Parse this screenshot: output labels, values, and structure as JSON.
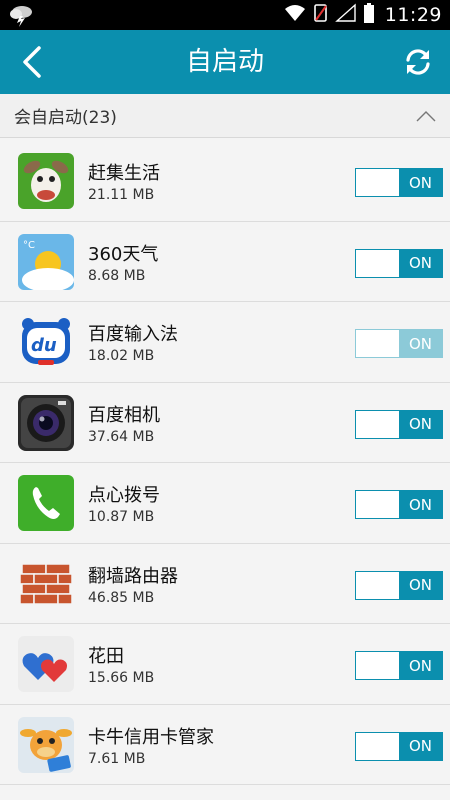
{
  "status_bar": {
    "time": "11:29",
    "icons": [
      "weather-icon",
      "wifi-icon",
      "sim-icon",
      "signal-icon",
      "battery-icon"
    ]
  },
  "app_bar": {
    "title": "自启动",
    "back_icon": "back-arrow-icon",
    "refresh_icon": "refresh-icon"
  },
  "section": {
    "label": "会自启动(23)",
    "expand_icon": "chevron-up-icon"
  },
  "apps": [
    {
      "name": " 赶集生活",
      "size": "21.11 MB",
      "icon": "ganji-app-icon",
      "toggle": "ON",
      "dim": false
    },
    {
      "name": "360天气",
      "size": "8.68 MB",
      "icon": "weather360-app-icon",
      "toggle": "ON",
      "dim": false
    },
    {
      "name": "百度输入法",
      "size": "18.02 MB",
      "icon": "baidu-input-app-icon",
      "toggle": "ON",
      "dim": true
    },
    {
      "name": "百度相机",
      "size": "37.64 MB",
      "icon": "baidu-camera-app-icon",
      "toggle": "ON",
      "dim": false
    },
    {
      "name": "点心拨号",
      "size": "10.87 MB",
      "icon": "dianxin-dialer-app-icon",
      "toggle": "ON",
      "dim": false
    },
    {
      "name": "翻墙路由器",
      "size": "46.85 MB",
      "icon": "brick-wall-app-icon",
      "toggle": "ON",
      "dim": false
    },
    {
      "name": "花田",
      "size": "15.66 MB",
      "icon": "huatian-hearts-app-icon",
      "toggle": "ON",
      "dim": false
    },
    {
      "name": "卡牛信用卡管家",
      "size": "7.61 MB",
      "icon": "kaniu-app-icon",
      "toggle": "ON",
      "dim": false
    }
  ],
  "colors": {
    "accent": "#0b8fae",
    "accent_dim": "#8ccad8",
    "background": "#f4f4f4"
  }
}
